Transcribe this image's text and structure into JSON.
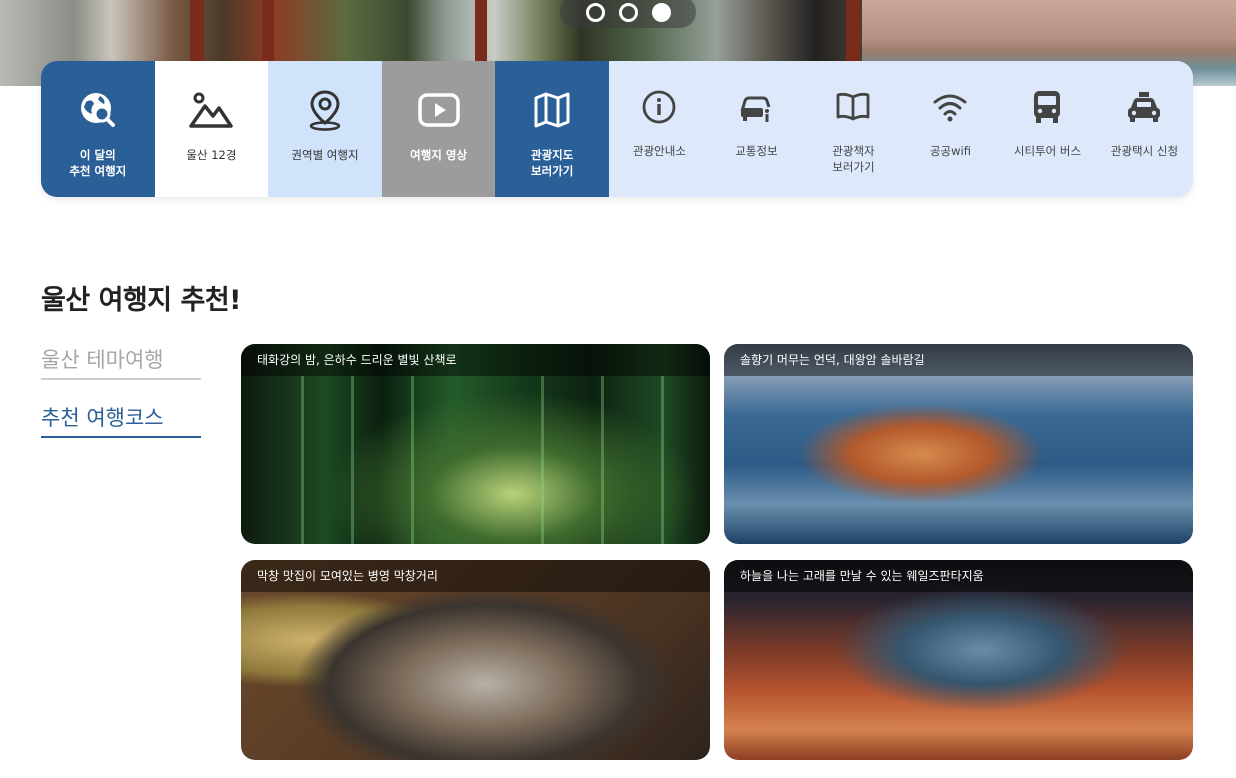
{
  "hero": {
    "slide_dots": [
      {
        "label": "slide-1",
        "active": false
      },
      {
        "label": "slide-2",
        "active": false
      },
      {
        "label": "slide-3",
        "active": true
      }
    ]
  },
  "quick_menu": {
    "featured": [
      {
        "label": "이 달의\n추천 여행지",
        "icon": "globe-search-icon"
      },
      {
        "label": "울산 12경",
        "icon": "mountain-icon"
      },
      {
        "label": "권역별 여행지",
        "icon": "map-pin-icon"
      },
      {
        "label": "여행지 영상",
        "icon": "video-play-icon"
      },
      {
        "label": "관광지도\n보러가기",
        "icon": "folded-map-icon"
      }
    ],
    "utility": [
      {
        "label": "관광안내소",
        "icon": "info-icon"
      },
      {
        "label": "교통정보",
        "icon": "car-info-icon"
      },
      {
        "label": "관광책자\n보러가기",
        "icon": "open-book-icon"
      },
      {
        "label": "공공wifi",
        "icon": "wifi-icon"
      },
      {
        "label": "시티투어 버스",
        "icon": "bus-icon"
      },
      {
        "label": "관광택시 신청",
        "icon": "taxi-icon"
      }
    ]
  },
  "recommend": {
    "title": "울산 여행지 추천!",
    "tabs": [
      {
        "label": "울산 테마여행",
        "active": false
      },
      {
        "label": "추천 여행코스",
        "active": true
      }
    ],
    "cards": [
      {
        "caption": "태화강의 밤, 은하수 드리운 별빛 산책로"
      },
      {
        "caption": "솔향기 머무는 언덕, 대왕암 솔바람길"
      },
      {
        "caption": "막창 맛집이 모여있는 병영 막창거리"
      },
      {
        "caption": "하늘을 나는 고래를 만날 수 있는 웨일즈판타지움"
      }
    ]
  },
  "colors": {
    "primary_blue": "#2b5f97",
    "menu_bg": "#dde9fa",
    "gray_tile": "#9c9c9c"
  }
}
